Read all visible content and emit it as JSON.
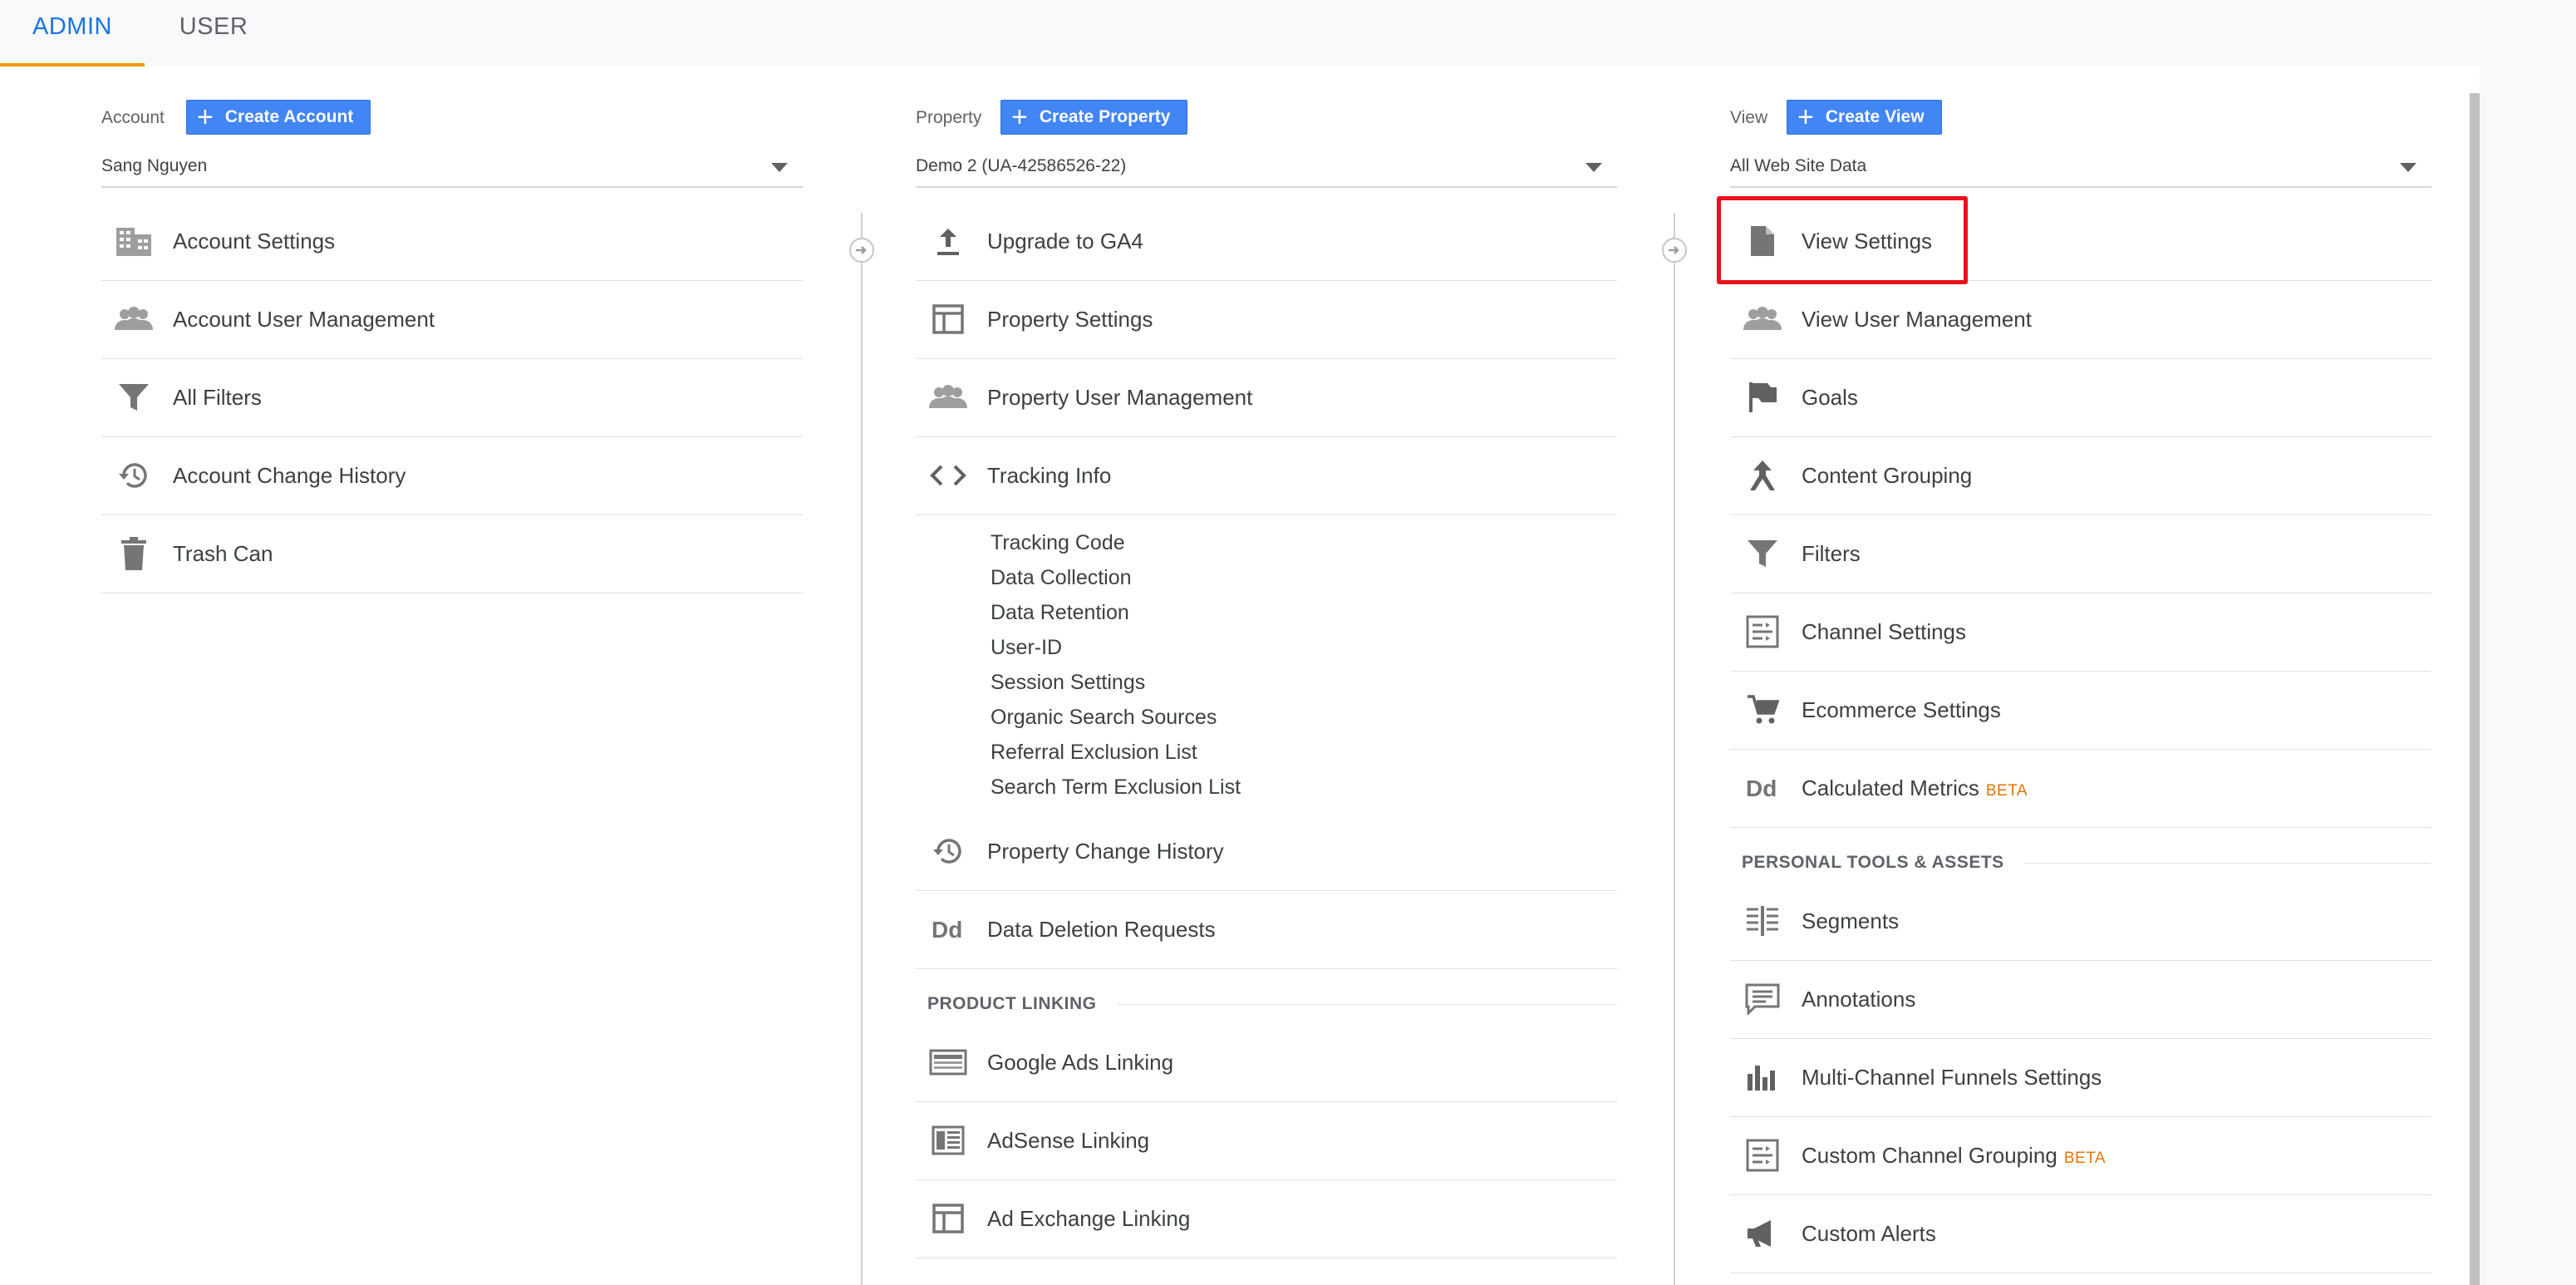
{
  "tabs": {
    "admin": "ADMIN",
    "user": "USER"
  },
  "colors": {
    "accent": "#1a73e8",
    "tab_underline": "#f29900",
    "button": "#4285f4",
    "beta": "#e37400",
    "highlight": "#e8111c"
  },
  "account": {
    "label": "Account",
    "create_button": "Create Account",
    "selected": "Sang Nguyen",
    "items": [
      {
        "label": "Account Settings",
        "icon": "building-icon"
      },
      {
        "label": "Account User Management",
        "icon": "people-icon"
      },
      {
        "label": "All Filters",
        "icon": "filter-icon"
      },
      {
        "label": "Account Change History",
        "icon": "history-icon"
      },
      {
        "label": "Trash Can",
        "icon": "trash-icon"
      }
    ]
  },
  "property": {
    "label": "Property",
    "create_button": "Create Property",
    "selected": "Demo 2 (UA-42586526-22)",
    "items": [
      {
        "label": "Upgrade to GA4",
        "icon": "upload-icon"
      },
      {
        "label": "Property Settings",
        "icon": "layout-icon"
      },
      {
        "label": "Property User Management",
        "icon": "people-icon"
      },
      {
        "label": "Tracking Info",
        "icon": "code-icon"
      }
    ],
    "tracking_subitems": [
      "Tracking Code",
      "Data Collection",
      "Data Retention",
      "User-ID",
      "Session Settings",
      "Organic Search Sources",
      "Referral Exclusion List",
      "Search Term Exclusion List"
    ],
    "items_after": [
      {
        "label": "Property Change History",
        "icon": "history-icon"
      },
      {
        "label": "Data Deletion Requests",
        "icon": "dd-icon"
      }
    ],
    "product_linking_header": "PRODUCT LINKING",
    "linking_items": [
      {
        "label": "Google Ads Linking",
        "icon": "ads-icon"
      },
      {
        "label": "AdSense Linking",
        "icon": "adsense-icon"
      },
      {
        "label": "Ad Exchange Linking",
        "icon": "layout-icon"
      }
    ]
  },
  "view": {
    "label": "View",
    "create_button": "Create View",
    "selected": "All Web Site Data",
    "items": [
      {
        "label": "View Settings",
        "icon": "document-icon"
      },
      {
        "label": "View User Management",
        "icon": "people-icon"
      },
      {
        "label": "Goals",
        "icon": "flag-icon"
      },
      {
        "label": "Content Grouping",
        "icon": "grouping-icon"
      },
      {
        "label": "Filters",
        "icon": "filter-icon"
      },
      {
        "label": "Channel Settings",
        "icon": "channel-icon"
      },
      {
        "label": "Ecommerce Settings",
        "icon": "cart-icon"
      },
      {
        "label": "Calculated Metrics",
        "icon": "dd-icon",
        "badge": "BETA"
      }
    ],
    "personal_tools_header": "PERSONAL TOOLS & ASSETS",
    "personal_items": [
      {
        "label": "Segments",
        "icon": "segments-icon"
      },
      {
        "label": "Annotations",
        "icon": "annotation-icon"
      },
      {
        "label": "Multi-Channel Funnels Settings",
        "icon": "bar-chart-icon"
      },
      {
        "label": "Custom Channel Grouping",
        "icon": "channel-icon",
        "badge": "BETA"
      },
      {
        "label": "Custom Alerts",
        "icon": "megaphone-icon"
      }
    ]
  }
}
